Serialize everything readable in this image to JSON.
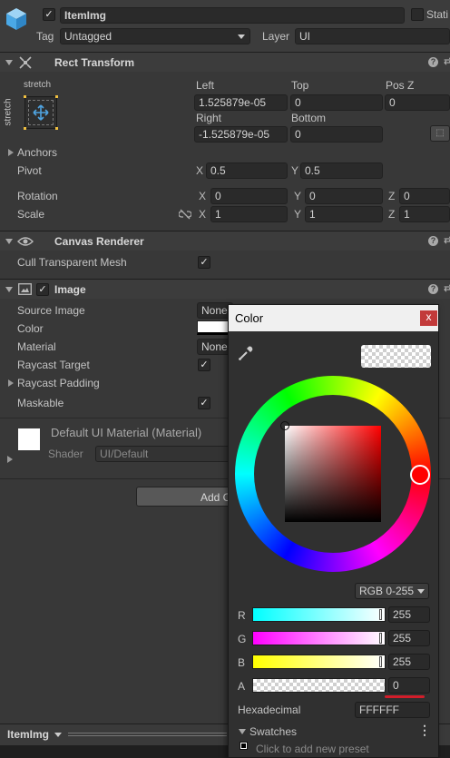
{
  "header": {
    "object_name": "ItemImg",
    "active_checked": "✓",
    "static_label": "Stati",
    "tag_label": "Tag",
    "tag_value": "Untagged",
    "layer_label": "Layer",
    "layer_value": "UI"
  },
  "rect_transform": {
    "title": "Rect Transform",
    "anchor_preset_top": "stretch",
    "anchor_preset_side": "stretch",
    "left_label": "Left",
    "left_value": "1.525879e-05",
    "top_label": "Top",
    "top_value": "0",
    "posz_label": "Pos Z",
    "posz_value": "0",
    "right_label": "Right",
    "right_value": "-1.525879e-05",
    "bottom_label": "Bottom",
    "bottom_value": "0",
    "anchors_label": "Anchors",
    "pivot_label": "Pivot",
    "pivot_x": "0.5",
    "pivot_y": "0.5",
    "rotation_label": "Rotation",
    "rot_x": "0",
    "rot_y": "0",
    "rot_z": "0",
    "scale_label": "Scale",
    "scale_x": "1",
    "scale_y": "1",
    "scale_z": "1",
    "x": "X",
    "y": "Y",
    "z": "Z"
  },
  "canvas_renderer": {
    "title": "Canvas Renderer",
    "cull_label": "Cull Transparent Mesh",
    "cull_checked": "✓"
  },
  "image": {
    "title": "Image",
    "enabled_checked": "✓",
    "source_image_label": "Source Image",
    "source_image_value": "None",
    "color_label": "Color",
    "material_label": "Material",
    "material_value": "None",
    "raycast_target_label": "Raycast Target",
    "raycast_target_checked": "✓",
    "raycast_padding_label": "Raycast Padding",
    "maskable_label": "Maskable",
    "maskable_checked": "✓"
  },
  "material_preview": {
    "name": "Default UI Material (Material)",
    "shader_label": "Shader",
    "shader_value": "UI/Default"
  },
  "add_component": {
    "label": "Add C"
  },
  "bottom_bar": {
    "label": "ItemImg"
  },
  "color_picker": {
    "title": "Color",
    "close_label": "x",
    "mode": "RGB 0-255",
    "channels": [
      {
        "label": "R",
        "value": "255"
      },
      {
        "label": "G",
        "value": "255"
      },
      {
        "label": "B",
        "value": "255"
      },
      {
        "label": "A",
        "value": "0"
      }
    ],
    "hex_label": "Hexadecimal",
    "hex_value": "FFFFFF",
    "swatches_label": "Swatches",
    "add_preset": "Click to add new preset"
  }
}
